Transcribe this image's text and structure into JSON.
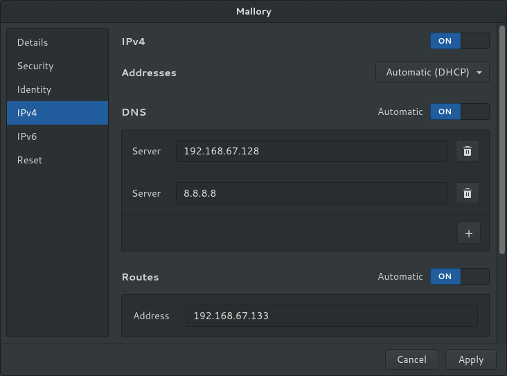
{
  "window": {
    "title": "Mallory"
  },
  "sidebar": {
    "items": [
      {
        "label": "Details"
      },
      {
        "label": "Security"
      },
      {
        "label": "Identity"
      },
      {
        "label": "IPv4"
      },
      {
        "label": "IPv6"
      },
      {
        "label": "Reset"
      }
    ],
    "selected_index": 3
  },
  "ipv4": {
    "title": "IPv4",
    "toggle_on": "ON",
    "addresses_label": "Addresses",
    "addresses_mode": "Automatic (DHCP)",
    "dns": {
      "title": "DNS",
      "automatic_label": "Automatic",
      "toggle_on": "ON",
      "server_label": "Server",
      "servers": [
        {
          "value": "192.168.67.128"
        },
        {
          "value": "8.8.8.8"
        }
      ],
      "add_icon": "+"
    },
    "routes": {
      "title": "Routes",
      "automatic_label": "Automatic",
      "toggle_on": "ON",
      "address_label": "Address",
      "address_value": "192.168.67.133"
    }
  },
  "footer": {
    "cancel": "Cancel",
    "apply": "Apply"
  }
}
